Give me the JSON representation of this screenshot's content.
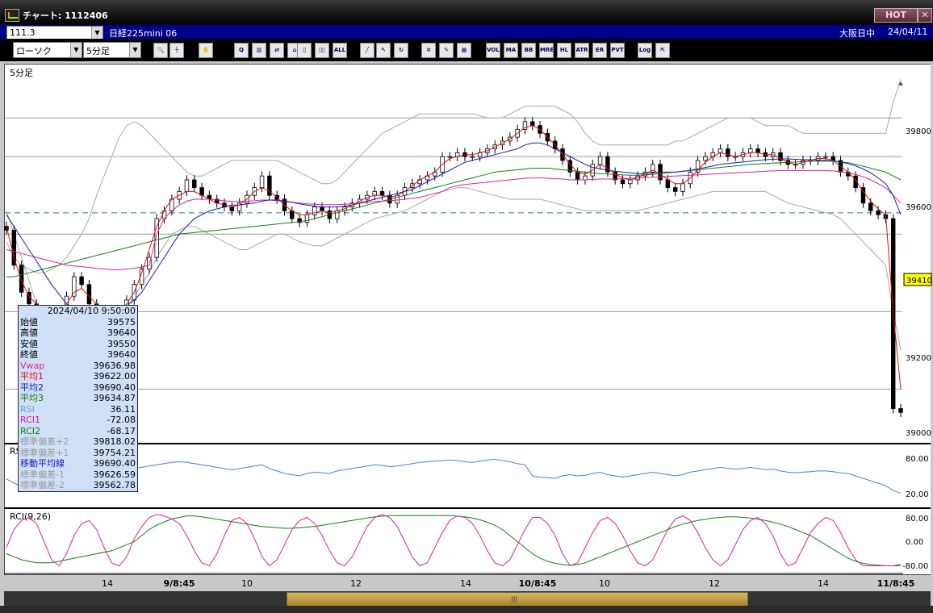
{
  "window": {
    "title": "チャート: 1112406",
    "hot_label": "HOT",
    "close_label": "✕"
  },
  "header": {
    "code_value": "111.3",
    "symbol": "日経225mini 06",
    "market": "大阪日中",
    "date": "24/04/11"
  },
  "toolbar": {
    "chart_type": "ローソク",
    "interval": "5分足",
    "buttons": [
      {
        "name": "zoom-icon",
        "label": "🔍"
      },
      {
        "name": "crosshair-icon",
        "label": "┼"
      },
      {
        "name": "hand-icon",
        "label": "✋"
      },
      {
        "name": "magnify-chart-icon",
        "label": "Q"
      },
      {
        "name": "bar-chart-icon",
        "label": "▥"
      },
      {
        "name": "swap-icon",
        "label": "⇄"
      },
      {
        "name": "bell-icon",
        "label": "⌂"
      },
      {
        "name": "candle-icon",
        "label": "▯"
      },
      {
        "name": "candle-multi-icon",
        "label": "▯▯"
      },
      {
        "name": "all-icon",
        "label": "ALL"
      },
      {
        "name": "trendline-icon",
        "label": "╱"
      },
      {
        "name": "cursor-icon",
        "label": "↖"
      },
      {
        "name": "rotate-icon",
        "label": "↻"
      },
      {
        "name": "gear-icon",
        "label": "✲"
      },
      {
        "name": "brush-icon",
        "label": "✎"
      },
      {
        "name": "palette-icon",
        "label": "▦"
      },
      {
        "name": "vol-icon",
        "label": "VOL"
      },
      {
        "name": "ma-icon",
        "label": "MA"
      },
      {
        "name": "bb-icon",
        "label": "BB"
      },
      {
        "name": "mre-icon",
        "label": "MRE"
      },
      {
        "name": "hl-icon",
        "label": "HL"
      },
      {
        "name": "atr-icon",
        "label": "ATR"
      },
      {
        "name": "er-icon",
        "label": "ER"
      },
      {
        "name": "pvt-icon",
        "label": "PVT"
      },
      {
        "name": "log-icon",
        "label": "Log"
      },
      {
        "name": "export-icon",
        "label": "⇱"
      }
    ]
  },
  "main_panel": {
    "label": "5分足"
  },
  "price_axis": {
    "ticks": [
      {
        "label": "39800",
        "value": 39800
      },
      {
        "label": "39600",
        "value": 39600
      },
      {
        "label": "39200",
        "value": 39200
      },
      {
        "label": "39000",
        "value": 39000
      }
    ],
    "current_price": "39410"
  },
  "rsi_panel": {
    "label": "RSI",
    "ticks": [
      "80.00",
      "20.00"
    ]
  },
  "rci_panel": {
    "label": "RCI(9,26)",
    "ticks": [
      "80.00",
      "0.00",
      "-80.00"
    ]
  },
  "x_axis": {
    "labels": [
      "14",
      "9/8:45",
      "10",
      "12",
      "14",
      "10/8:45",
      "10",
      "12",
      "14",
      "11/8:45"
    ]
  },
  "info_box": {
    "header": "2024/04/10 9:50:00",
    "rows": [
      {
        "label": "始値",
        "value": "39575",
        "color": "#000000"
      },
      {
        "label": "高値",
        "value": "39640",
        "color": "#000000"
      },
      {
        "label": "安値",
        "value": "39550",
        "color": "#000000"
      },
      {
        "label": "終値",
        "value": "39640",
        "color": "#000000"
      },
      {
        "label": "Vwap",
        "value": "39636.98",
        "color": "#e0209c"
      },
      {
        "label": "平均1",
        "value": "39622.00",
        "color": "#e01010"
      },
      {
        "label": "平均2",
        "value": "39690.40",
        "color": "#1020c0"
      },
      {
        "label": "平均3",
        "value": "39634.87",
        "color": "#108010"
      },
      {
        "label": "RSI",
        "value": "36.11",
        "color": "#6aa0e0"
      },
      {
        "label": "RCI1",
        "value": "-72.08",
        "color": "#e0209c"
      },
      {
        "label": "RCI2",
        "value": "-68.17",
        "color": "#108010"
      },
      {
        "label": "標準偏差+2",
        "value": "39818.02",
        "color": "#9a9a9a"
      },
      {
        "label": "標準偏差+1",
        "value": "39754.21",
        "color": "#9a9a9a"
      },
      {
        "label": "移動平均線",
        "value": "39690.40",
        "color": "#1020c0"
      },
      {
        "label": "標準偏差-1",
        "value": "39626.59",
        "color": "#9a9a9a"
      },
      {
        "label": "標準偏差-2",
        "value": "39562.78",
        "color": "#9a9a9a"
      }
    ]
  },
  "chart_data": {
    "type": "line",
    "ylim": [
      38970,
      39900
    ],
    "reference_level": 39555,
    "close": [
      39510,
      39420,
      39350,
      39320,
      39300,
      39270,
      39260,
      39300,
      39340,
      39390,
      39370,
      39320,
      39300,
      39260,
      39250,
      39290,
      39330,
      39370,
      39410,
      39440,
      39540,
      39560,
      39590,
      39610,
      39640,
      39620,
      39600,
      39590,
      39580,
      39570,
      39560,
      39580,
      39600,
      39620,
      39650,
      39600,
      39590,
      39560,
      39540,
      39530,
      39550,
      39570,
      39560,
      39540,
      39560,
      39570,
      39580,
      39590,
      39600,
      39610,
      39600,
      39580,
      39600,
      39620,
      39630,
      39640,
      39650,
      39660,
      39700,
      39700,
      39710,
      39700,
      39700,
      39710,
      39720,
      39730,
      39740,
      39750,
      39770,
      39790,
      39780,
      39760,
      39740,
      39720,
      39690,
      39660,
      39640,
      39650,
      39680,
      39700,
      39660,
      39640,
      39630,
      39640,
      39650,
      39660,
      39680,
      39640,
      39620,
      39610,
      39630,
      39660,
      39690,
      39700,
      39710,
      39720,
      39700,
      39700,
      39710,
      39720,
      39710,
      39700,
      39710,
      39690,
      39680,
      39680,
      39690,
      39690,
      39700,
      39700,
      39690,
      39660,
      39650,
      39620,
      39580,
      39560,
      39550,
      39540,
      39050,
      39040
    ],
    "ma1": [
      39520,
      39440,
      39380,
      39340,
      39320,
      39300,
      39290,
      39300,
      39320,
      39350,
      39360,
      39340,
      39320,
      39300,
      39290,
      39300,
      39320,
      39350,
      39400,
      39460,
      39520,
      39560,
      39590,
      39600,
      39610,
      39610,
      39600,
      39590,
      39580,
      39575,
      39570,
      39575,
      39590,
      39610,
      39620,
      39610,
      39595,
      39575,
      39560,
      39550,
      39550,
      39555,
      39560,
      39555,
      39560,
      39565,
      39575,
      39585,
      39595,
      39600,
      39600,
      39595,
      39600,
      39610,
      39625,
      39640,
      39650,
      39660,
      39680,
      39695,
      39700,
      39705,
      39705,
      39710,
      39715,
      39725,
      39735,
      39745,
      39760,
      39775,
      39780,
      39770,
      39750,
      39730,
      39705,
      39680,
      39660,
      39655,
      39665,
      39680,
      39670,
      39655,
      39645,
      39640,
      39645,
      39655,
      39665,
      39655,
      39640,
      39630,
      39630,
      39645,
      39665,
      39685,
      39700,
      39710,
      39705,
      39700,
      39705,
      39710,
      39710,
      39705,
      39705,
      39695,
      39685,
      39680,
      39685,
      39690,
      39695,
      39695,
      39690,
      39675,
      39660,
      39640,
      39610,
      39585,
      39565,
      39550,
      39300,
      39100
    ],
    "ma2": [
      39550,
      39520,
      39490,
      39460,
      39430,
      39400,
      39370,
      39345,
      39320,
      39310,
      39300,
      39300,
      39300,
      39300,
      39300,
      39305,
      39315,
      39330,
      39350,
      39380,
      39410,
      39440,
      39470,
      39500,
      39520,
      39540,
      39550,
      39560,
      39565,
      39570,
      39575,
      39575,
      39578,
      39580,
      39585,
      39588,
      39588,
      39585,
      39582,
      39578,
      39575,
      39572,
      39570,
      39570,
      39570,
      39572,
      39575,
      39580,
      39585,
      39590,
      39595,
      39600,
      39605,
      39610,
      39615,
      39625,
      39635,
      39645,
      39655,
      39665,
      39675,
      39685,
      39690,
      39695,
      39700,
      39705,
      39710,
      39715,
      39720,
      39730,
      39735,
      39735,
      39730,
      39720,
      39710,
      39700,
      39690,
      39680,
      39672,
      39668,
      39665,
      39662,
      39660,
      39658,
      39656,
      39656,
      39658,
      39660,
      39660,
      39660,
      39662,
      39665,
      39668,
      39672,
      39676,
      39680,
      39682,
      39684,
      39686,
      39688,
      39690,
      39692,
      39693,
      39694,
      39694,
      39693,
      39692,
      39692,
      39691,
      39690,
      39689,
      39686,
      39682,
      39676,
      39668,
      39658,
      39645,
      39630,
      39600,
      39550
    ],
    "ma3": [
      39390,
      39390,
      39395,
      39400,
      39405,
      39410,
      39415,
      39420,
      39425,
      39430,
      39435,
      39440,
      39445,
      39450,
      39455,
      39460,
      39465,
      39470,
      39475,
      39480,
      39485,
      39490,
      39495,
      39500,
      39502,
      39504,
      39506,
      39508,
      39510,
      39512,
      39514,
      39516,
      39518,
      39520,
      39522,
      39524,
      39526,
      39528,
      39530,
      39532,
      39535,
      39540,
      39545,
      39550,
      39555,
      39560,
      39565,
      39570,
      39575,
      39580,
      39585,
      39590,
      39595,
      39600,
      39605,
      39610,
      39615,
      39620,
      39625,
      39630,
      39635,
      39640,
      39645,
      39650,
      39655,
      39660,
      39662,
      39664,
      39666,
      39668,
      39670,
      39670,
      39670,
      39668,
      39666,
      39664,
      39662,
      39660,
      39658,
      39656,
      39655,
      39654,
      39653,
      39652,
      39652,
      39653,
      39654,
      39656,
      39658,
      39660,
      39662,
      39664,
      39666,
      39668,
      39670,
      39672,
      39674,
      39676,
      39678,
      39680,
      39681,
      39682,
      39683,
      39684,
      39685,
      39686,
      39687,
      39688,
      39688,
      39688,
      39688,
      39686,
      39684,
      39680,
      39675,
      39670,
      39665,
      39660,
      39650,
      39640
    ],
    "vwap": [
      39460,
      39455,
      39450,
      39445,
      39440,
      39435,
      39430,
      39425,
      39420,
      39418,
      39416,
      39414,
      39412,
      39410,
      39408,
      39408,
      39410,
      39412,
      39415,
      39420,
      39500,
      39540,
      39560,
      39575,
      39585,
      39590,
      39590,
      39590,
      39588,
      39586,
      39584,
      39584,
      39585,
      39586,
      39588,
      39588,
      39586,
      39584,
      39582,
      39580,
      39578,
      39577,
      39576,
      39576,
      39576,
      39577,
      39578,
      39580,
      39582,
      39584,
      39585,
      39586,
      39588,
      39590,
      39592,
      39595,
      39600,
      39605,
      39610,
      39620,
      39625,
      39628,
      39630,
      39632,
      39634,
      39636,
      39638,
      39640,
      39642,
      39644,
      39645,
      39645,
      39644,
      39643,
      39642,
      39640,
      39640,
      39640,
      39641,
      39642,
      39642,
      39642,
      39643,
      39644,
      39645,
      39646,
      39647,
      39648,
      39649,
      39650,
      39651,
      39652,
      39653,
      39654,
      39655,
      39656,
      39657,
      39658,
      39659,
      39660,
      39661,
      39662,
      39663,
      39664,
      39664,
      39664,
      39664,
      39664,
      39664,
      39664,
      39663,
      39661,
      39658,
      39654,
      39648,
      39640,
      39630,
      39620,
      39600,
      39580
    ],
    "bb_upper": [
      39480,
      39440,
      39420,
      39410,
      39400,
      39400,
      39410,
      39420,
      39440,
      39470,
      39500,
      39540,
      39600,
      39650,
      39700,
      39750,
      39780,
      39790,
      39780,
      39760,
      39740,
      39720,
      39700,
      39680,
      39660,
      39650,
      39650,
      39660,
      39670,
      39680,
      39690,
      39690,
      39690,
      39690,
      39690,
      39690,
      39690,
      39680,
      39670,
      39660,
      39650,
      39640,
      39630,
      39630,
      39640,
      39660,
      39680,
      39700,
      39720,
      39740,
      39760,
      39770,
      39780,
      39790,
      39800,
      39810,
      39810,
      39810,
      39810,
      39810,
      39810,
      39810,
      39810,
      39805,
      39800,
      39800,
      39800,
      39810,
      39820,
      39830,
      39830,
      39830,
      39830,
      39830,
      39820,
      39810,
      39790,
      39760,
      39740,
      39730,
      39730,
      39730,
      39730,
      39730,
      39730,
      39730,
      39730,
      39730,
      39730,
      39740,
      39740,
      39750,
      39760,
      39770,
      39780,
      39790,
      39800,
      39800,
      39800,
      39800,
      39790,
      39780,
      39780,
      39780,
      39780,
      39770,
      39760,
      39760,
      39760,
      39760,
      39760,
      39760,
      39760,
      39760,
      39760,
      39760,
      39760,
      39760,
      39840,
      39900
    ],
    "bb_lower": [
      39560,
      39500,
      39440,
      39380,
      39320,
      39270,
      39220,
      39180,
      39160,
      39150,
      39150,
      39160,
      39180,
      39200,
      39230,
      39270,
      39310,
      39340,
      39370,
      39400,
      39440,
      39470,
      39500,
      39510,
      39520,
      39520,
      39510,
      39500,
      39490,
      39480,
      39470,
      39460,
      39460,
      39470,
      39480,
      39490,
      39500,
      39500,
      39490,
      39480,
      39475,
      39470,
      39470,
      39480,
      39490,
      39500,
      39510,
      39520,
      39530,
      39540,
      39545,
      39550,
      39555,
      39560,
      39570,
      39580,
      39590,
      39600,
      39610,
      39615,
      39620,
      39620,
      39615,
      39610,
      39605,
      39600,
      39595,
      39590,
      39590,
      39590,
      39590,
      39590,
      39585,
      39580,
      39575,
      39570,
      39565,
      39560,
      39560,
      39560,
      39560,
      39560,
      39560,
      39560,
      39560,
      39565,
      39570,
      39575,
      39580,
      39585,
      39590,
      39595,
      39600,
      39605,
      39610,
      39610,
      39610,
      39610,
      39610,
      39610,
      39610,
      39610,
      39600,
      39590,
      39580,
      39575,
      39570,
      39565,
      39560,
      39555,
      39550,
      39540,
      39520,
      39500,
      39480,
      39460,
      39440,
      39420,
      39300,
      39200
    ],
    "rsi": [
      45,
      38,
      33,
      30,
      32,
      35,
      40,
      45,
      50,
      48,
      44,
      42,
      40,
      44,
      48,
      52,
      58,
      62,
      64,
      66,
      68,
      70,
      72,
      73,
      72,
      70,
      68,
      66,
      64,
      62,
      60,
      62,
      64,
      66,
      68,
      62,
      58,
      54,
      52,
      50,
      54,
      56,
      55,
      54,
      58,
      60,
      62,
      64,
      66,
      68,
      67,
      65,
      66,
      68,
      70,
      72,
      73,
      74,
      75,
      76,
      75,
      73,
      72,
      74,
      76,
      77,
      75,
      73,
      70,
      68,
      50,
      48,
      47,
      46,
      50,
      52,
      50,
      51,
      54,
      56,
      52,
      50,
      48,
      50,
      52,
      54,
      56,
      54,
      52,
      50,
      52,
      56,
      58,
      60,
      62,
      64,
      62,
      61,
      62,
      64,
      62,
      60,
      61,
      58,
      56,
      55,
      56,
      57,
      58,
      58,
      57,
      55,
      54,
      50,
      46,
      42,
      38,
      34,
      26,
      22
    ],
    "rci1": [
      -20,
      40,
      70,
      80,
      60,
      0,
      -60,
      -80,
      -40,
      20,
      60,
      70,
      40,
      -20,
      -70,
      -80,
      -50,
      10,
      50,
      80,
      90,
      85,
      75,
      60,
      20,
      -30,
      -70,
      -80,
      -40,
      20,
      70,
      80,
      60,
      10,
      -50,
      -80,
      -60,
      -10,
      40,
      70,
      80,
      60,
      20,
      -30,
      -70,
      -80,
      -50,
      0,
      50,
      80,
      90,
      80,
      50,
      0,
      -50,
      -80,
      -70,
      -20,
      30,
      70,
      85,
      80,
      60,
      20,
      -30,
      -70,
      -80,
      -60,
      -10,
      40,
      80,
      80,
      60,
      20,
      -40,
      -80,
      -70,
      -20,
      30,
      70,
      80,
      60,
      20,
      -30,
      -70,
      -80,
      -60,
      -10,
      40,
      75,
      85,
      70,
      30,
      -20,
      -60,
      -80,
      -60,
      -10,
      40,
      70,
      80,
      60,
      20,
      -40,
      -80,
      -70,
      -20,
      30,
      60,
      80,
      70,
      30,
      -20,
      -60,
      -80,
      -80,
      -80,
      -80,
      -80,
      -75
    ],
    "rci2": [
      -40,
      -50,
      -60,
      -65,
      -70,
      -70,
      -70,
      -65,
      -60,
      -55,
      -50,
      -45,
      -40,
      -35,
      -30,
      -20,
      -10,
      0,
      20,
      40,
      55,
      65,
      75,
      80,
      85,
      85,
      82,
      78,
      74,
      70,
      66,
      62,
      58,
      54,
      50,
      48,
      46,
      44,
      44,
      46,
      48,
      50,
      54,
      58,
      62,
      66,
      70,
      74,
      78,
      82,
      84,
      86,
      86,
      86,
      86,
      86,
      86,
      86,
      86,
      86,
      84,
      82,
      78,
      72,
      64,
      54,
      40,
      20,
      0,
      -20,
      -40,
      -55,
      -65,
      -72,
      -76,
      -78,
      -76,
      -70,
      -60,
      -50,
      -40,
      -30,
      -20,
      -10,
      0,
      10,
      20,
      30,
      40,
      50,
      58,
      64,
      70,
      74,
      78,
      80,
      82,
      82,
      80,
      78,
      74,
      70,
      64,
      58,
      50,
      40,
      30,
      20,
      5,
      -10,
      -25,
      -40,
      -55,
      -65,
      -72,
      -76,
      -78,
      -80,
      -80,
      -80
    ]
  }
}
